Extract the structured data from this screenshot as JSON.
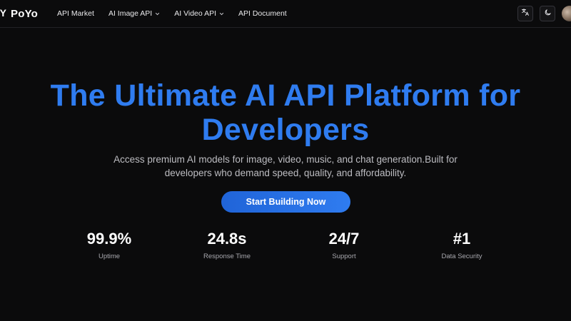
{
  "header": {
    "logo_mark": "Y",
    "logo_text": "PoYo",
    "nav": [
      {
        "label": "API Market",
        "dropdown": false
      },
      {
        "label": "AI Image API",
        "dropdown": true
      },
      {
        "label": "AI Video API",
        "dropdown": true
      },
      {
        "label": "API Document",
        "dropdown": false
      }
    ],
    "icons": {
      "translate": "translate-icon",
      "theme": "moon-icon",
      "chevron": "chevron-down-icon"
    }
  },
  "hero": {
    "title_line1": "The Ultimate AI API Platform for",
    "title_line2": "Developers",
    "subtitle_line1": "Access premium AI models for image, video, music, and chat generation.Built for",
    "subtitle_line2": "developers who demand speed, quality, and affordability.",
    "cta_label": "Start Building Now"
  },
  "stats": [
    {
      "value": "99.9%",
      "label": "Uptime"
    },
    {
      "value": "24.8s",
      "label": "Response Time"
    },
    {
      "value": "24/7",
      "label": "Support"
    },
    {
      "value": "#1",
      "label": "Data Security"
    }
  ],
  "colors": {
    "background": "#0b0b0c",
    "accent": "#2f7cf0",
    "cta_start": "#2064d8",
    "text_muted": "#bdbdc2"
  }
}
